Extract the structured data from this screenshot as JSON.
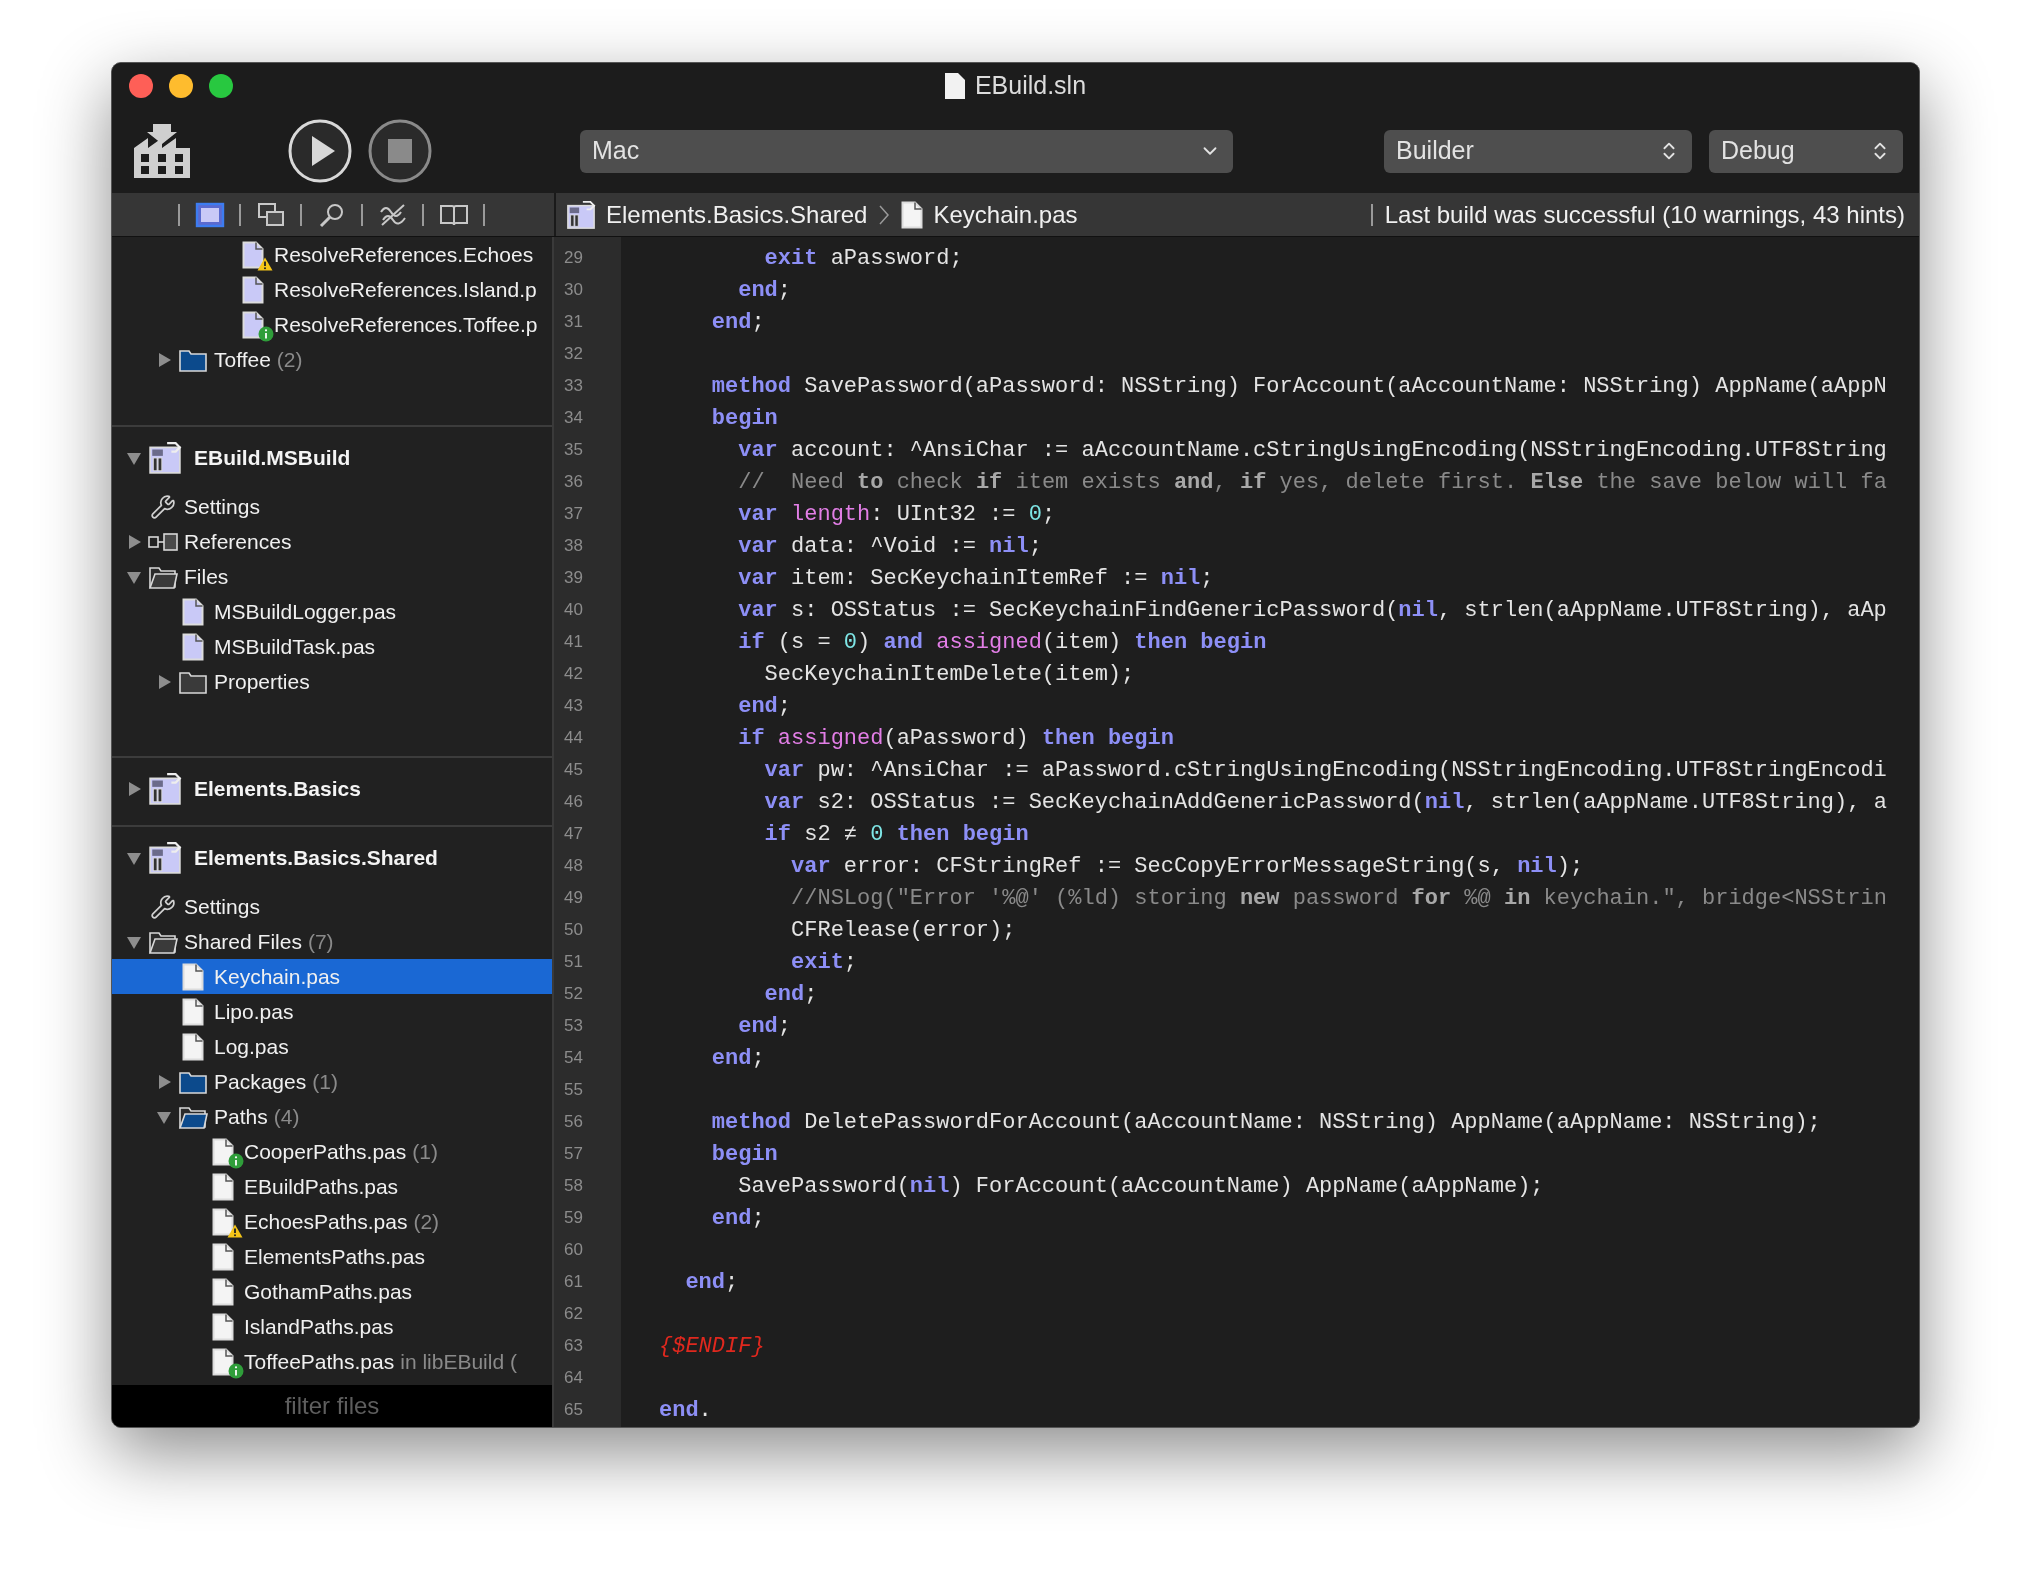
{
  "window": {
    "title": "EBuild.sln"
  },
  "toolbar": {
    "scheme": {
      "value": "Mac"
    },
    "builder": {
      "value": "Builder"
    },
    "configuration": {
      "value": "Debug"
    }
  },
  "navigator_tabs": [
    {
      "selected": true
    },
    {
      "selected": false
    },
    {
      "selected": false
    },
    {
      "selected": false
    },
    {
      "selected": false
    }
  ],
  "breadcrumb": [
    "Elements.Basics.Shared",
    "Keychain.pas"
  ],
  "build_status": "Last build was successful (10 warnings, 43 hints)",
  "sidebar": {
    "sections": [
      {
        "items": [
          {
            "children": [
              {
                "children": [
                  {
                    "children": [
                      {
                        "label": "ResolveReferences.Echoes",
                        "kind": "file",
                        "color": "#c9c9f7",
                        "warning": true,
                        "selected": false
                      },
                      {
                        "label": "ResolveReferences.Island.p",
                        "kind": "file",
                        "color": "#c9c9f7",
                        "selected": false
                      },
                      {
                        "label": "ResolveReferences.Toffee.p",
                        "kind": "file",
                        "color": "#c9c9f7",
                        "info": true,
                        "selected": false
                      }
                    ]
                  }
                ]
              },
              {
                "label": "Toffee",
                "count": "(2)",
                "kind": "folder",
                "color": "#0c4a8c",
                "expanded": false,
                "selected": false
              }
            ]
          }
        ]
      },
      {
        "header": {
          "label": "EBuild.MSBuild",
          "expanded": true
        },
        "items": [
          {
            "label": "Settings",
            "kind": "settings",
            "selected": false
          },
          {
            "label": "References",
            "kind": "references",
            "expanded": false,
            "selected": false
          },
          {
            "label": "Files",
            "kind": "folder",
            "color": "#3a3a3a",
            "expanded": true,
            "selected": false,
            "children": [
              {
                "label": "MSBuildLogger.pas",
                "kind": "file",
                "color": "#c9c9f7",
                "selected": false
              },
              {
                "label": "MSBuildTask.pas",
                "kind": "file",
                "color": "#c9c9f7",
                "selected": false
              },
              {
                "label": "Properties",
                "kind": "folder",
                "color": "#3a3a3a",
                "expanded": false,
                "selected": false
              }
            ]
          }
        ]
      },
      {
        "header": {
          "label": "Elements.Basics",
          "expanded": false
        }
      },
      {
        "header": {
          "label": "Elements.Basics.Shared",
          "expanded": true
        },
        "items": [
          {
            "label": "Settings",
            "kind": "settings",
            "selected": false
          },
          {
            "label": "Shared Files",
            "count": "(7)",
            "kind": "folder",
            "color": "#3a3a3a",
            "expanded": true,
            "selected": false,
            "children": [
              {
                "label": "Keychain.pas",
                "kind": "file",
                "color": "#f4f4f4",
                "selected": true
              },
              {
                "label": "Lipo.pas",
                "kind": "file",
                "color": "#f4f4f4",
                "selected": false
              },
              {
                "label": "Log.pas",
                "kind": "file",
                "color": "#f4f4f4",
                "selected": false
              },
              {
                "label": "Packages",
                "count": "(1)",
                "kind": "folder",
                "color": "#0c4a8c",
                "expanded": false,
                "selected": false
              },
              {
                "label": "Paths",
                "count": "(4)",
                "kind": "folder",
                "color": "#0c4a8c",
                "expanded": true,
                "selected": false,
                "children": [
                  {
                    "label": "CooperPaths.pas",
                    "count": "(1)",
                    "kind": "file",
                    "color": "#f4f4f4",
                    "info": true,
                    "selected": false
                  },
                  {
                    "label": "EBuildPaths.pas",
                    "kind": "file",
                    "color": "#f4f4f4",
                    "selected": false
                  },
                  {
                    "label": "EchoesPaths.pas",
                    "count": "(2)",
                    "kind": "file",
                    "color": "#f4f4f4",
                    "warning": true,
                    "selected": false
                  },
                  {
                    "label": "ElementsPaths.pas",
                    "kind": "file",
                    "color": "#f4f4f4",
                    "selected": false
                  },
                  {
                    "label": "GothamPaths.pas",
                    "kind": "file",
                    "color": "#f4f4f4",
                    "selected": false
                  },
                  {
                    "label": "IslandPaths.pas",
                    "kind": "file",
                    "color": "#f4f4f4",
                    "selected": false
                  },
                  {
                    "label": "ToffeePaths.pas",
                    "count": "in libEBuild (",
                    "kind": "file",
                    "color": "#f4f4f4",
                    "info": true,
                    "selected": false
                  }
                ]
              }
            ]
          }
        ]
      }
    ],
    "filter": {
      "placeholder": "filter files"
    }
  },
  "editor": {
    "lines": [
      {
        "number": "29",
        "tokens": [
          {
            "kind": "keyword",
            "text": "        exit"
          },
          {
            "kind": "plain",
            "text": " aPassword;"
          }
        ]
      },
      {
        "number": "30",
        "tokens": [
          {
            "kind": "keyword",
            "text": "      end"
          },
          {
            "kind": "plain",
            "text": ";"
          }
        ]
      },
      {
        "number": "31",
        "tokens": [
          {
            "kind": "keyword",
            "text": "    end"
          },
          {
            "kind": "plain",
            "text": ";"
          }
        ]
      },
      {
        "number": "32"
      },
      {
        "number": "33",
        "tokens": [
          {
            "kind": "keyword",
            "text": "    method"
          },
          {
            "kind": "plain",
            "text": " SavePassword(aPassword: NSString) ForAccount(aAccountName: NSString) AppName(aAppN"
          }
        ]
      },
      {
        "number": "34",
        "tokens": [
          {
            "kind": "keyword",
            "text": "    begin"
          }
        ]
      },
      {
        "number": "35",
        "tokens": [
          {
            "kind": "keyword",
            "text": "      var"
          },
          {
            "kind": "plain",
            "text": " account: ^AnsiChar := aAccountName.cStringUsingEncoding(NSStringEncoding.UTF8String"
          }
        ]
      },
      {
        "number": "36",
        "tokens": [
          {
            "kind": "comment",
            "text": "      //  Need "
          },
          {
            "kind": "comment_keyword",
            "text": "to"
          },
          {
            "kind": "comment",
            "text": " check "
          },
          {
            "kind": "comment_keyword",
            "text": "if"
          },
          {
            "kind": "comment",
            "text": " item exists "
          },
          {
            "kind": "comment_keyword",
            "text": "and"
          },
          {
            "kind": "comment",
            "text": ", "
          },
          {
            "kind": "comment_keyword",
            "text": "if"
          },
          {
            "kind": "comment",
            "text": " yes, delete first. "
          },
          {
            "kind": "comment_keyword",
            "text": "Else"
          },
          {
            "kind": "comment",
            "text": " the save below will fa"
          }
        ]
      },
      {
        "number": "37",
        "tokens": [
          {
            "kind": "keyword",
            "text": "      var"
          },
          {
            "kind": "builtin",
            "text": " length"
          },
          {
            "kind": "plain",
            "text": ": UInt32 := "
          },
          {
            "kind": "number",
            "text": "0"
          },
          {
            "kind": "plain",
            "text": ";"
          }
        ]
      },
      {
        "number": "38",
        "tokens": [
          {
            "kind": "keyword",
            "text": "      var"
          },
          {
            "kind": "plain",
            "text": " data: ^Void := "
          },
          {
            "kind": "keyword",
            "text": "nil"
          },
          {
            "kind": "plain",
            "text": ";"
          }
        ]
      },
      {
        "number": "39",
        "tokens": [
          {
            "kind": "keyword",
            "text": "      var"
          },
          {
            "kind": "plain",
            "text": " item: SecKeychainItemRef := "
          },
          {
            "kind": "keyword",
            "text": "nil"
          },
          {
            "kind": "plain",
            "text": ";"
          }
        ]
      },
      {
        "number": "40",
        "tokens": [
          {
            "kind": "keyword",
            "text": "      var"
          },
          {
            "kind": "plain",
            "text": " s: OSStatus := SecKeychainFindGenericPassword("
          },
          {
            "kind": "keyword",
            "text": "nil"
          },
          {
            "kind": "plain",
            "text": ", strlen(aAppName.UTF8String), aAp"
          }
        ]
      },
      {
        "number": "41",
        "tokens": [
          {
            "kind": "keyword",
            "text": "      if"
          },
          {
            "kind": "plain",
            "text": " (s = "
          },
          {
            "kind": "number",
            "text": "0"
          },
          {
            "kind": "plain",
            "text": ") "
          },
          {
            "kind": "keyword",
            "text": "and"
          },
          {
            "kind": "builtin",
            "text": " assigned"
          },
          {
            "kind": "plain",
            "text": "(item) "
          },
          {
            "kind": "keyword",
            "text": "then"
          },
          {
            "kind": "keyword",
            "text": " begin"
          }
        ]
      },
      {
        "number": "42",
        "tokens": [
          {
            "kind": "plain",
            "text": "        SecKeychainItemDelete(item);"
          }
        ]
      },
      {
        "number": "43",
        "tokens": [
          {
            "kind": "keyword",
            "text": "      end"
          },
          {
            "kind": "plain",
            "text": ";"
          }
        ]
      },
      {
        "number": "44",
        "tokens": [
          {
            "kind": "keyword",
            "text": "      if"
          },
          {
            "kind": "builtin",
            "text": " assigned"
          },
          {
            "kind": "plain",
            "text": "(aPassword) "
          },
          {
            "kind": "keyword",
            "text": "then"
          },
          {
            "kind": "keyword",
            "text": " begin"
          }
        ]
      },
      {
        "number": "45",
        "tokens": [
          {
            "kind": "keyword",
            "text": "        var"
          },
          {
            "kind": "plain",
            "text": " pw: ^AnsiChar := aPassword.cStringUsingEncoding(NSStringEncoding.UTF8StringEncodi"
          }
        ]
      },
      {
        "number": "46",
        "tokens": [
          {
            "kind": "keyword",
            "text": "        var"
          },
          {
            "kind": "plain",
            "text": " s2: OSStatus := SecKeychainAddGenericPassword("
          },
          {
            "kind": "keyword",
            "text": "nil"
          },
          {
            "kind": "plain",
            "text": ", strlen(aAppName.UTF8String), a"
          }
        ]
      },
      {
        "number": "47",
        "tokens": [
          {
            "kind": "keyword",
            "text": "        if"
          },
          {
            "kind": "plain",
            "text": " s2 ≠ "
          },
          {
            "kind": "number",
            "text": "0"
          },
          {
            "kind": "keyword",
            "text": " then"
          },
          {
            "kind": "keyword",
            "text": " begin"
          }
        ]
      },
      {
        "number": "48",
        "tokens": [
          {
            "kind": "keyword",
            "text": "          var"
          },
          {
            "kind": "plain",
            "text": " error: CFStringRef := SecCopyErrorMessageString(s, "
          },
          {
            "kind": "keyword",
            "text": "nil"
          },
          {
            "kind": "plain",
            "text": ");"
          }
        ]
      },
      {
        "number": "49",
        "tokens": [
          {
            "kind": "comment",
            "text": "          //NSLog(\"Error '%@' (%ld) storing "
          },
          {
            "kind": "comment_keyword",
            "text": "new"
          },
          {
            "kind": "comment",
            "text": " password "
          },
          {
            "kind": "comment_keyword",
            "text": "for"
          },
          {
            "kind": "comment",
            "text": " %@ "
          },
          {
            "kind": "comment_keyword",
            "text": "in"
          },
          {
            "kind": "comment",
            "text": " keychain.\", bridge<NSStrin"
          }
        ]
      },
      {
        "number": "50",
        "tokens": [
          {
            "kind": "plain",
            "text": "          CFRelease(error);"
          }
        ]
      },
      {
        "number": "51",
        "tokens": [
          {
            "kind": "keyword",
            "text": "          exit"
          },
          {
            "kind": "plain",
            "text": ";"
          }
        ]
      },
      {
        "number": "52",
        "tokens": [
          {
            "kind": "keyword",
            "text": "        end"
          },
          {
            "kind": "plain",
            "text": ";"
          }
        ]
      },
      {
        "number": "53",
        "tokens": [
          {
            "kind": "keyword",
            "text": "      end"
          },
          {
            "kind": "plain",
            "text": ";"
          }
        ]
      },
      {
        "number": "54",
        "tokens": [
          {
            "kind": "keyword",
            "text": "    end"
          },
          {
            "kind": "plain",
            "text": ";"
          }
        ]
      },
      {
        "number": "55"
      },
      {
        "number": "56",
        "tokens": [
          {
            "kind": "keyword",
            "text": "    method"
          },
          {
            "kind": "plain",
            "text": " DeletePasswordForAccount(aAccountName: NSString) AppName(aAppName: NSString);"
          }
        ]
      },
      {
        "number": "57",
        "tokens": [
          {
            "kind": "keyword",
            "text": "    begin"
          }
        ]
      },
      {
        "number": "58",
        "tokens": [
          {
            "kind": "plain",
            "text": "      SavePassword("
          },
          {
            "kind": "keyword",
            "text": "nil"
          },
          {
            "kind": "plain",
            "text": ") ForAccount(aAccountName) AppName(aAppName);"
          }
        ]
      },
      {
        "number": "59",
        "tokens": [
          {
            "kind": "keyword",
            "text": "    end"
          },
          {
            "kind": "plain",
            "text": ";"
          }
        ]
      },
      {
        "number": "60"
      },
      {
        "number": "61",
        "tokens": [
          {
            "kind": "keyword",
            "text": "  end"
          },
          {
            "kind": "plain",
            "text": ";"
          }
        ]
      },
      {
        "number": "62"
      },
      {
        "number": "63",
        "tokens": [
          {
            "kind": "directive",
            "text": "{$ENDIF}"
          }
        ]
      },
      {
        "number": "64"
      },
      {
        "number": "65",
        "tokens": [
          {
            "kind": "keyword",
            "text": "end"
          },
          {
            "kind": "plain",
            "text": "."
          }
        ]
      }
    ]
  }
}
